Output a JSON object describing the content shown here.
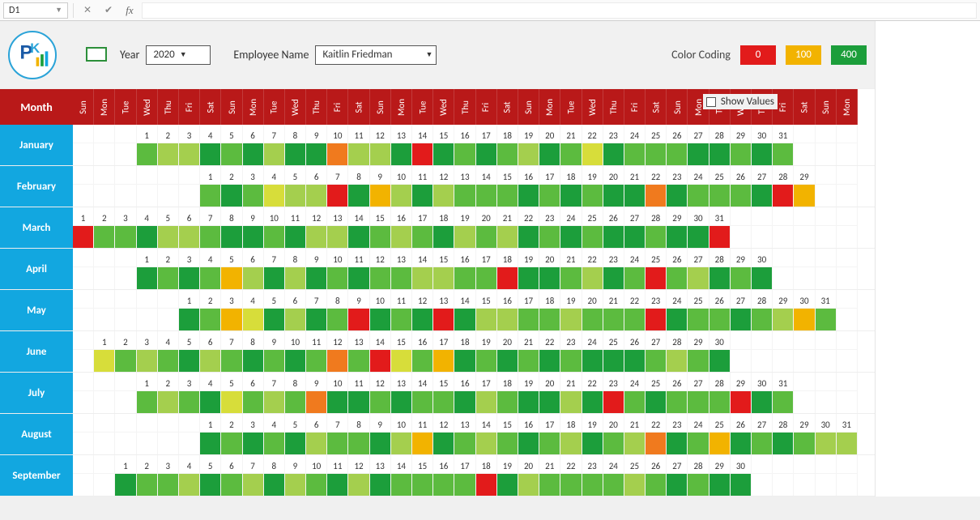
{
  "cellRef": "D1",
  "labels": {
    "year": "Year",
    "employee": "Employee Name",
    "colorCoding": "Color Coding",
    "showValues": "Show Values",
    "monthHeader": "Month"
  },
  "controls": {
    "year": "2020",
    "employee": "Kaitlin Friedman",
    "showValuesChecked": false
  },
  "colorCoding": {
    "low": "0",
    "mid": "100",
    "high": "400"
  },
  "dow": [
    "Sun",
    "Mon",
    "Tue",
    "Wed",
    "Thu",
    "Fri",
    "Sat"
  ],
  "cols": 37,
  "firstDowIndex": 0,
  "months": [
    {
      "name": "January",
      "start": 3,
      "days": 31,
      "heat": [
        5,
        4,
        4,
        6,
        5,
        6,
        4,
        6,
        6,
        1,
        4,
        4,
        6,
        0,
        6,
        5,
        6,
        5,
        4,
        6,
        5,
        3,
        6,
        5,
        5,
        5,
        6,
        6,
        5,
        6,
        5
      ]
    },
    {
      "name": "February",
      "start": 6,
      "days": 29,
      "heat": [
        5,
        6,
        5,
        3,
        4,
        4,
        0,
        6,
        2,
        4,
        6,
        4,
        5,
        5,
        5,
        6,
        5,
        6,
        5,
        6,
        6,
        1,
        6,
        5,
        5,
        5,
        6,
        0,
        2
      ]
    },
    {
      "name": "March",
      "start": 0,
      "days": 31,
      "heat": [
        0,
        5,
        5,
        6,
        4,
        4,
        5,
        6,
        6,
        5,
        6,
        4,
        4,
        6,
        5,
        4,
        5,
        6,
        4,
        5,
        4,
        6,
        5,
        6,
        5,
        6,
        6,
        5,
        6,
        6,
        0
      ]
    },
    {
      "name": "April",
      "start": 3,
      "days": 30,
      "heat": [
        6,
        5,
        6,
        5,
        2,
        4,
        6,
        4,
        6,
        5,
        6,
        5,
        5,
        4,
        4,
        5,
        5,
        0,
        6,
        6,
        5,
        4,
        6,
        5,
        0,
        5,
        4,
        6,
        5,
        6
      ]
    },
    {
      "name": "May",
      "start": 5,
      "days": 31,
      "heat": [
        6,
        5,
        2,
        3,
        6,
        4,
        6,
        5,
        0,
        6,
        5,
        6,
        0,
        6,
        4,
        4,
        5,
        5,
        4,
        5,
        5,
        5,
        0,
        6,
        5,
        5,
        6,
        5,
        4,
        2,
        5
      ]
    },
    {
      "name": "June",
      "start": 1,
      "days": 30,
      "heat": [
        3,
        5,
        4,
        5,
        6,
        4,
        5,
        6,
        5,
        6,
        5,
        1,
        5,
        0,
        3,
        5,
        2,
        6,
        5,
        6,
        5,
        6,
        5,
        6,
        6,
        6,
        5,
        4,
        5,
        6
      ]
    },
    {
      "name": "July",
      "start": 3,
      "days": 31,
      "heat": [
        5,
        4,
        5,
        6,
        3,
        5,
        4,
        5,
        1,
        6,
        6,
        5,
        6,
        5,
        5,
        6,
        4,
        5,
        6,
        6,
        4,
        6,
        0,
        5,
        6,
        5,
        5,
        5,
        0,
        6,
        5
      ]
    },
    {
      "name": "August",
      "start": 6,
      "days": 31,
      "heat": [
        6,
        5,
        6,
        5,
        6,
        4,
        5,
        5,
        6,
        4,
        2,
        6,
        5,
        4,
        5,
        6,
        5,
        4,
        6,
        5,
        4,
        1,
        6,
        5,
        2,
        6,
        5,
        6,
        5,
        4,
        4
      ]
    },
    {
      "name": "September",
      "start": 2,
      "days": 30,
      "heat": [
        6,
        5,
        5,
        4,
        6,
        5,
        4,
        6,
        4,
        5,
        6,
        4,
        6,
        5,
        5,
        5,
        5,
        0,
        6,
        4,
        5,
        5,
        5,
        5,
        4,
        5,
        6,
        5,
        6,
        6
      ]
    }
  ]
}
